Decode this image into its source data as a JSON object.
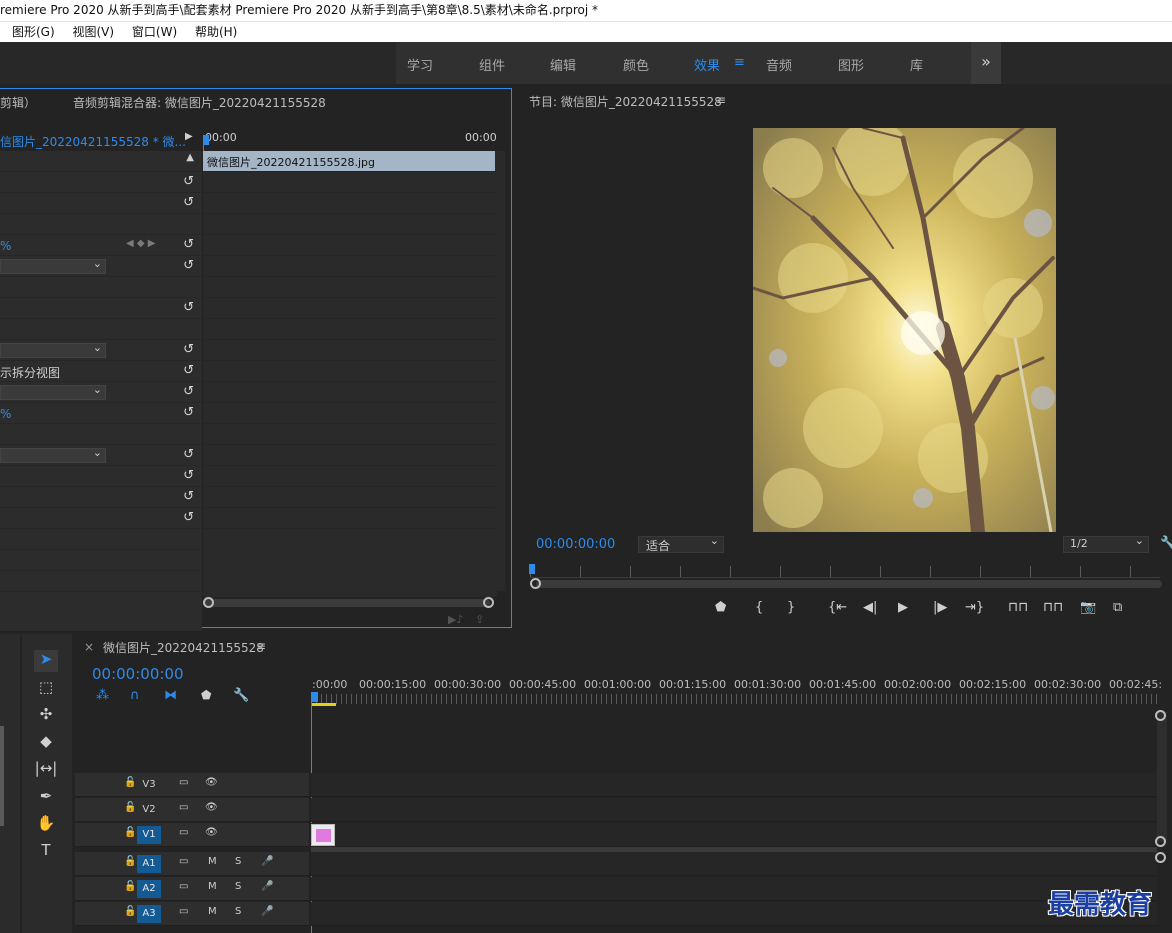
{
  "window": {
    "title": "remiere Pro 2020 从新手到高手\\配套素材 Premiere Pro 2020 从新手到高手\\第8章\\8.5\\素材\\未命名.prproj *"
  },
  "menu": [
    "图形(G)",
    "视图(V)",
    "窗口(W)",
    "帮助(H)"
  ],
  "workspaces": {
    "items": [
      "学习",
      "组件",
      "编辑",
      "颜色",
      "效果",
      "音频",
      "图形",
      "库"
    ],
    "active": "效果",
    "more": "»",
    "menu_icon": "≡"
  },
  "effect_controls": {
    "tab1": "剪辑）",
    "tab2": "音频剪辑混合器: 微信图片_20220421155528",
    "clip_label": "信图片_20220421155528 * 微...",
    "time_start": "00:00",
    "time_end": "00:00",
    "clip_bar": "微信图片_20220421155528.jpg",
    "percent1": "%",
    "split_view": "示拆分视图",
    "percent2": "%"
  },
  "program": {
    "title": "节目: 微信图片_20220421155528",
    "menu_icon": "≡",
    "timecode": "00:00:00:00",
    "fit": "适合",
    "resolution": "1/2"
  },
  "timeline": {
    "close": "×",
    "title": "微信图片_20220421155528",
    "menu_icon": "≡",
    "timecode": "00:00:00:00",
    "ruler": [
      ":00:00",
      "00:00:15:00",
      "00:00:30:00",
      "00:00:45:00",
      "00:01:00:00",
      "00:01:15:00",
      "00:01:30:00",
      "00:01:45:00",
      "00:02:00:00",
      "00:02:15:00",
      "00:02:30:00",
      "00:02:45:"
    ],
    "tracks": [
      {
        "label": "V3",
        "kind": "video",
        "active": false
      },
      {
        "label": "V2",
        "kind": "video",
        "active": false
      },
      {
        "label": "V1",
        "kind": "video",
        "active": true
      },
      {
        "label": "A1",
        "kind": "audio",
        "active": true
      },
      {
        "label": "A2",
        "kind": "audio",
        "active": true
      },
      {
        "label": "A3",
        "kind": "audio",
        "active": true
      }
    ],
    "mute": "M",
    "solo": "S"
  },
  "watermark": "最需教育",
  "colors": {
    "accent": "#2d8ceb",
    "clip": "#e07ae0",
    "track_active": "#145a95"
  }
}
